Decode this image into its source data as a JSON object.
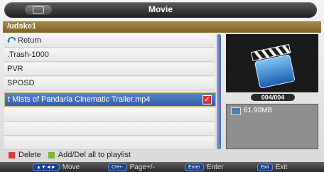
{
  "window": {
    "title": "Movie"
  },
  "path": "/udske1",
  "files": [
    {
      "label": "Return",
      "icon": "return-icon"
    },
    {
      "label": ".Trash-1000"
    },
    {
      "label": "PVR"
    },
    {
      "label": "SPOSD"
    },
    {
      "label": "t Mists of Pandaria Cinematic Trailer.mp4",
      "selected": true,
      "checked": true
    }
  ],
  "preview": {
    "icon": "clapperboard-icon",
    "counter": "004/004",
    "file_size": "61.90MB"
  },
  "legend": {
    "delete_label": "Delete",
    "delete_color": "#e23a3a",
    "add_label": "Add/Del all to playlist",
    "add_color": "#7ab83a"
  },
  "hints": [
    {
      "key": "▲▼◄►",
      "label": "Move"
    },
    {
      "key": "CH+-",
      "label": "Page+/-"
    },
    {
      "key": "Enter",
      "label": "Enter"
    },
    {
      "key": "Exit",
      "label": "Exit"
    }
  ]
}
